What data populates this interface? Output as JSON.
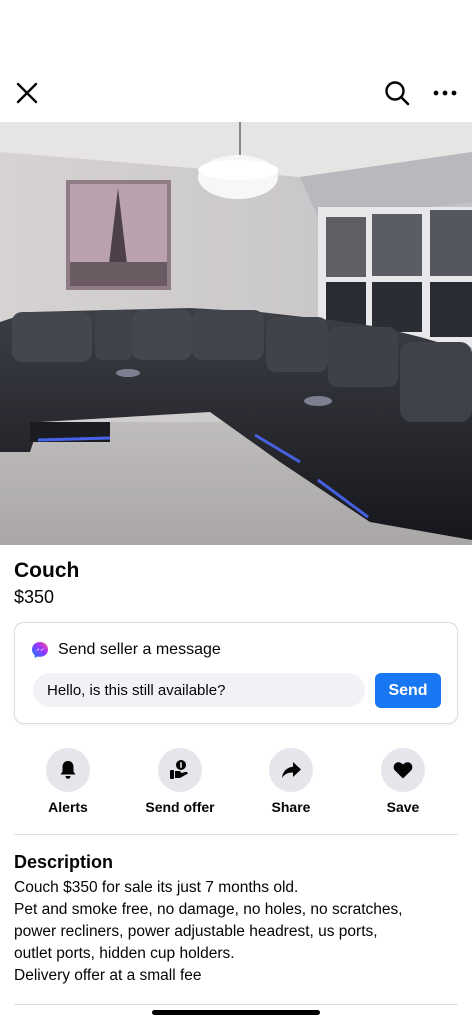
{
  "toolbar": {
    "close_icon": "close-icon",
    "search_icon": "search-icon",
    "more_icon": "more-options-icon"
  },
  "listing": {
    "photo_count": 6,
    "active_photo_index": 0,
    "title": "Couch",
    "price": "$350"
  },
  "message": {
    "header": "Send seller a message",
    "icon": "messenger-icon",
    "input_value": "Hello, is this still available?",
    "send_label": "Send",
    "accent_color": "#1877f2"
  },
  "actions": [
    {
      "label": "Alerts",
      "icon": "bell-icon"
    },
    {
      "label": "Send offer",
      "icon": "offer-hand-icon"
    },
    {
      "label": "Share",
      "icon": "share-arrow-icon"
    },
    {
      "label": "Save",
      "icon": "heart-icon"
    }
  ],
  "description": {
    "title": "Description",
    "lines": [
      "Couch $350 for sale its just 7 months old.",
      "Pet and smoke free, no damage, no holes, no scratches,",
      "power recliners, power adjustable headrest, us ports,",
      "outlet ports, hidden cup holders.",
      "Delivery offer at a small fee"
    ]
  }
}
